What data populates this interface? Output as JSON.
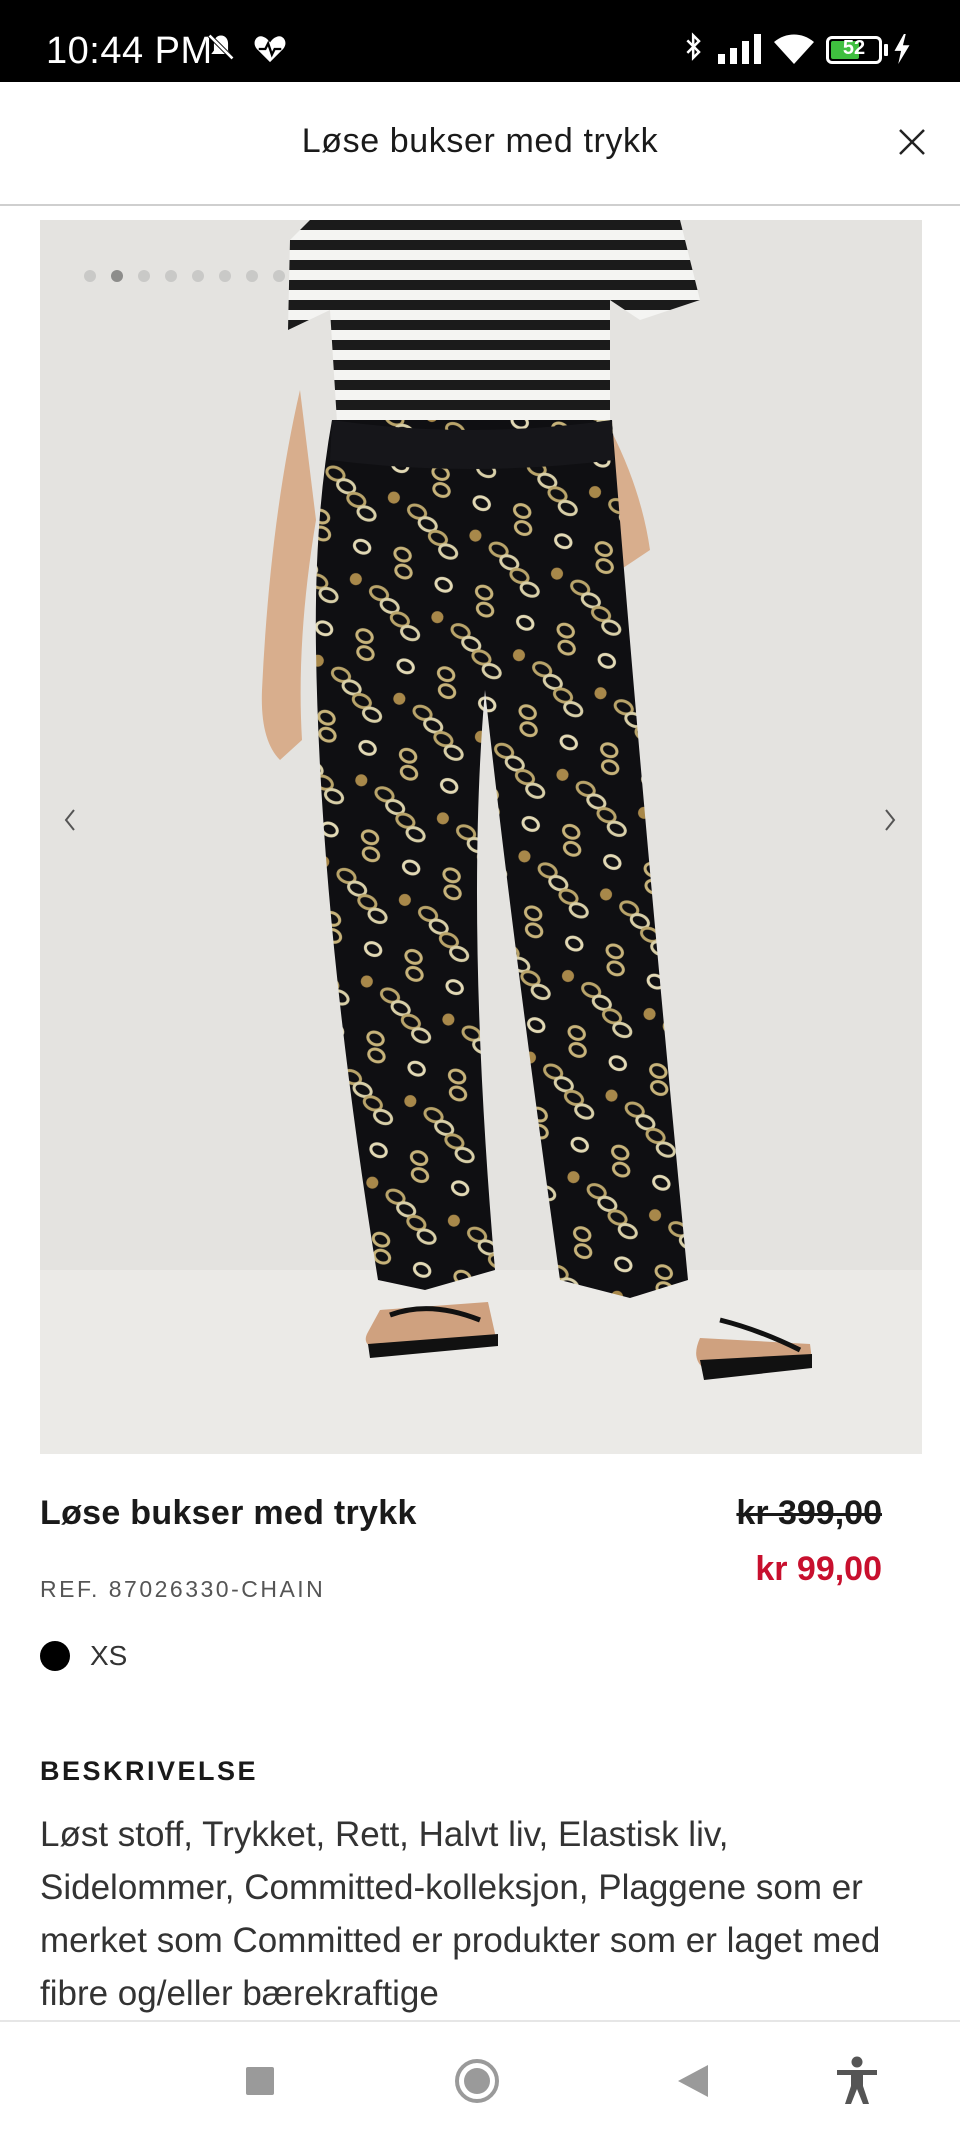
{
  "status_bar": {
    "time": "10:44 PM",
    "battery_level": "52",
    "icons": [
      "mute-icon",
      "heart-pulse-icon",
      "bluetooth-icon",
      "signal-icon",
      "wifi-icon",
      "battery-icon",
      "charging-icon"
    ]
  },
  "header": {
    "title": "Løse bukser med trykk",
    "close_icon": "close-icon"
  },
  "gallery": {
    "total_images": 8,
    "active_index": 1,
    "prev_icon": "chevron-left-icon",
    "next_icon": "chevron-right-icon"
  },
  "product": {
    "name": "Løse bukser med trykk",
    "price_old": "kr 399,00",
    "price_new": "kr 99,00",
    "reference": "REF. 87026330-CHAIN",
    "color_hex": "#000000",
    "size": "XS"
  },
  "description": {
    "heading": "BESKRIVELSE",
    "text": "Løst stoff, Trykket, Rett, Halvt liv, Elastisk liv, Sidelommer, Committed-kolleksjon, Plaggene som er merket som Committed er produkter som er laget med fibre og/eller bærekraftige"
  },
  "nav_bar": {
    "buttons": [
      "recents-square-icon",
      "home-circle-icon",
      "back-triangle-icon",
      "accessibility-icon"
    ]
  },
  "colors": {
    "sale_red": "#c8102e",
    "status_bar_bg": "#000000"
  }
}
